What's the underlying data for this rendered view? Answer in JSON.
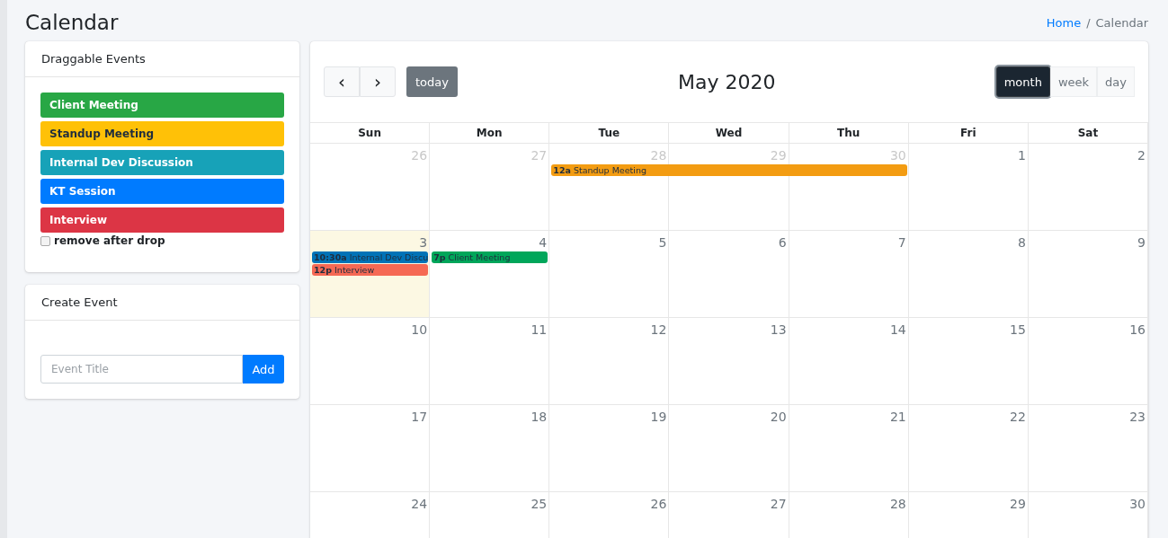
{
  "page_title": "Calendar",
  "breadcrumb": [
    {
      "label": "Home",
      "kind": "link"
    },
    {
      "label": "/",
      "kind": "separator"
    },
    {
      "label": "Calendar",
      "kind": "current"
    }
  ],
  "draggable_events": {
    "title": "Draggable Events",
    "items": [
      {
        "label": "Client Meeting",
        "color": "#28a745"
      },
      {
        "label": "Standup Meeting",
        "color": "#ffc107"
      },
      {
        "label": "Internal Dev Discussion",
        "color": "#17a2b8"
      },
      {
        "label": "KT Session",
        "color": "#007bff"
      },
      {
        "label": "Interview",
        "color": "#dc3545"
      }
    ],
    "remove_after_drop": {
      "label": "remove after drop",
      "checked": false
    }
  },
  "create_event": {
    "title": "Create Event",
    "placeholder": "Event Title",
    "button": "Add"
  },
  "calendar": {
    "prev": "‹",
    "next": "›",
    "today": "today",
    "title": "May 2020",
    "views": [
      {
        "label": "month",
        "selected": true
      },
      {
        "label": "week",
        "selected": false
      },
      {
        "label": "day",
        "selected": false
      }
    ],
    "weekdays": [
      "Sun",
      "Mon",
      "Tue",
      "Wed",
      "Thu",
      "Fri",
      "Sat"
    ],
    "weeks": [
      {
        "days": [
          {
            "label": "26",
            "other_month": true,
            "today": false
          },
          {
            "label": "27",
            "other_month": true,
            "today": false
          },
          {
            "label": "28",
            "other_month": true,
            "today": false,
            "events": [
              {
                "kind": "start",
                "time": "12a",
                "title": "Standup Meeting",
                "color": "#f39c12"
              }
            ]
          },
          {
            "label": "29",
            "other_month": true,
            "today": false,
            "events": [
              {
                "kind": "continuation",
                "color": "#f39c12"
              }
            ]
          },
          {
            "label": "30",
            "other_month": true,
            "today": false,
            "events": [
              {
                "kind": "continuation",
                "color": "#f39c12"
              }
            ]
          },
          {
            "label": "1",
            "other_month": false,
            "today": false
          },
          {
            "label": "2",
            "other_month": false,
            "today": false
          }
        ]
      },
      {
        "days": [
          {
            "label": "3",
            "other_month": false,
            "today": true,
            "events": [
              {
                "kind": "start",
                "time": "10:30a",
                "title": "Internal Dev Discu",
                "color": "#0073b7"
              },
              {
                "kind": "start",
                "time": "12p",
                "title": "Interview",
                "color": "#f56954"
              }
            ]
          },
          {
            "label": "4",
            "other_month": false,
            "today": false,
            "events": [
              {
                "kind": "start",
                "time": "7p",
                "title": "Client Meeting",
                "color": "#00a65a"
              }
            ]
          },
          {
            "label": "5",
            "other_month": false,
            "today": false
          },
          {
            "label": "6",
            "other_month": false,
            "today": false
          },
          {
            "label": "7",
            "other_month": false,
            "today": false
          },
          {
            "label": "8",
            "other_month": false,
            "today": false
          },
          {
            "label": "9",
            "other_month": false,
            "today": false
          }
        ]
      },
      {
        "days": [
          {
            "label": "10",
            "other_month": false,
            "today": false
          },
          {
            "label": "11",
            "other_month": false,
            "today": false
          },
          {
            "label": "12",
            "other_month": false,
            "today": false
          },
          {
            "label": "13",
            "other_month": false,
            "today": false
          },
          {
            "label": "14",
            "other_month": false,
            "today": false
          },
          {
            "label": "15",
            "other_month": false,
            "today": false
          },
          {
            "label": "16",
            "other_month": false,
            "today": false
          }
        ]
      },
      {
        "days": [
          {
            "label": "17",
            "other_month": false,
            "today": false
          },
          {
            "label": "18",
            "other_month": false,
            "today": false
          },
          {
            "label": "19",
            "other_month": false,
            "today": false
          },
          {
            "label": "20",
            "other_month": false,
            "today": false
          },
          {
            "label": "21",
            "other_month": false,
            "today": false
          },
          {
            "label": "22",
            "other_month": false,
            "today": false
          },
          {
            "label": "23",
            "other_month": false,
            "today": false
          }
        ]
      },
      {
        "days": [
          {
            "label": "24",
            "other_month": false,
            "today": false
          },
          {
            "label": "25",
            "other_month": false,
            "today": false
          },
          {
            "label": "26",
            "other_month": false,
            "today": false
          },
          {
            "label": "27",
            "other_month": false,
            "today": false
          },
          {
            "label": "28",
            "other_month": false,
            "today": false
          },
          {
            "label": "29",
            "other_month": false,
            "today": false
          },
          {
            "label": "30",
            "other_month": false,
            "today": false
          }
        ]
      }
    ]
  }
}
